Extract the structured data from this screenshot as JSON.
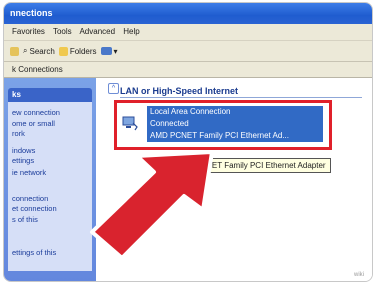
{
  "window": {
    "title": "nnections"
  },
  "menu": {
    "items": [
      "Favorites",
      "Tools",
      "Advanced",
      "Help"
    ]
  },
  "toolbar": {
    "search_label": "Search",
    "folders_label": "Folders",
    "views_label": ""
  },
  "address": {
    "text": "k Connections"
  },
  "sidebar": {
    "header": "ks",
    "links": [
      "ew connection",
      "ome or small",
      "rork",
      "indows",
      "ettings",
      "ie network",
      "",
      "connection",
      "et connection",
      "s of this",
      "",
      "ettings of this"
    ]
  },
  "content": {
    "group_title": "LAN or High-Speed Internet",
    "connection": {
      "name": "Local Area Connection",
      "status": "Connected",
      "device": "AMD PCNET Family PCI Ethernet Ad..."
    },
    "tooltip": "AMD PCNET Family PCI Ethernet Adapter",
    "scroll_glyph": "^"
  },
  "watermark": "wiki",
  "colors": {
    "highlight_box": "#e0202a",
    "selection": "#316ac5",
    "arrow": "#d9232e"
  }
}
